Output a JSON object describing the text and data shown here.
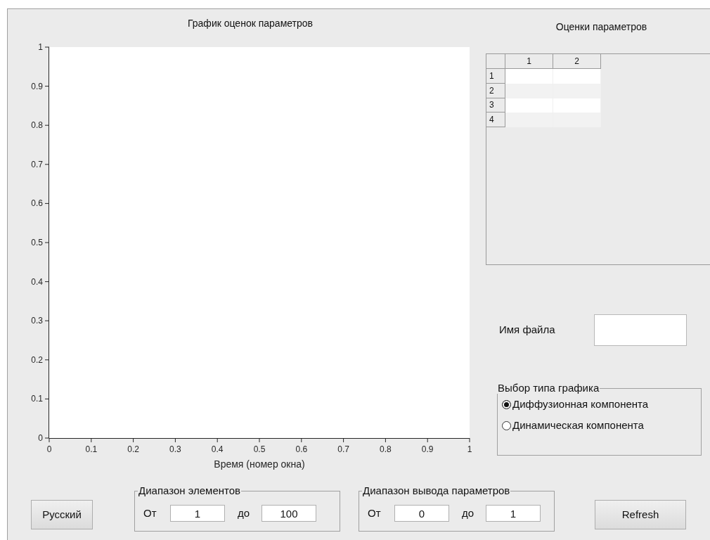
{
  "plot": {
    "chart_data": {
      "type": "line",
      "title": "График оценок параметров",
      "xlabel": "Время (номер окна)",
      "xlim": [
        0,
        1
      ],
      "ylim": [
        0,
        1
      ],
      "xticks": [
        0,
        0.1,
        0.2,
        0.3,
        0.4,
        0.5,
        0.6,
        0.7,
        0.8,
        0.9,
        1
      ],
      "yticks": [
        0,
        0.1,
        0.2,
        0.3,
        0.4,
        0.5,
        0.6,
        0.7,
        0.8,
        0.9,
        1
      ]
    }
  },
  "estimates": {
    "title": "Оценки параметров",
    "columns": [
      "1",
      "2"
    ],
    "rows": [
      {
        "label": "1"
      },
      {
        "label": "2"
      },
      {
        "label": "3"
      },
      {
        "label": "4"
      }
    ]
  },
  "file_name": {
    "label": "Имя файла"
  },
  "plot_type": {
    "title": "Выбор типа графика",
    "options": [
      {
        "label": "Диффузионная компонента",
        "selected": true
      },
      {
        "label": "Динамическая компонента",
        "selected": false
      }
    ]
  },
  "language_button": "Русский",
  "element_range": {
    "title": "Диапазон элементов",
    "from_label": "От",
    "from": "1",
    "to_label": "до",
    "to": "100"
  },
  "output_range": {
    "title": "Диапазон вывода параметров",
    "from_label": "От",
    "from": "0",
    "to_label": "до",
    "to": "1"
  },
  "refresh_button": "Refresh"
}
